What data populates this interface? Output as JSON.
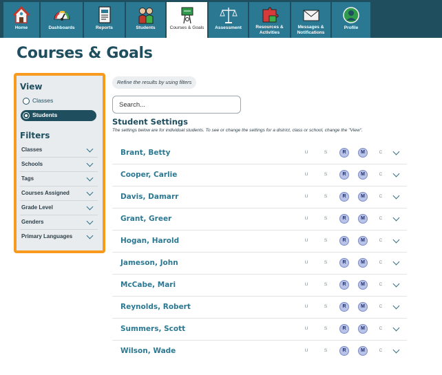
{
  "nav": {
    "items": [
      {
        "label": "Home",
        "icon": "home-icon"
      },
      {
        "label": "Dashboards",
        "icon": "dashboard-gauge-icon"
      },
      {
        "label": "Reports",
        "icon": "report-document-icon"
      },
      {
        "label": "Students",
        "icon": "students-icon"
      },
      {
        "label": "Courses & Goals",
        "icon": "courses-goals-icon",
        "active": true
      },
      {
        "label": "Assessment",
        "icon": "scale-icon"
      },
      {
        "label": "Resources & Activities",
        "line1": "Resources &",
        "line2": "Activities",
        "icon": "puzzle-icon"
      },
      {
        "label": "Messages & Notifications",
        "line1": "Messages &",
        "line2": "Notifications",
        "icon": "envelope-icon"
      },
      {
        "label": "Profile",
        "icon": "profile-avatar-icon"
      }
    ]
  },
  "page": {
    "title": "Courses & Goals"
  },
  "sidebar": {
    "view_heading": "View",
    "view_options": [
      {
        "label": "Classes",
        "selected": false
      },
      {
        "label": "Students",
        "selected": true
      }
    ],
    "filters_heading": "Filters",
    "filters": [
      {
        "label": "Classes"
      },
      {
        "label": "Schools"
      },
      {
        "label": "Tags"
      },
      {
        "label": "Courses Assigned"
      },
      {
        "label": "Grade Level"
      },
      {
        "label": "Genders"
      },
      {
        "label": "Primary Languages"
      }
    ]
  },
  "main": {
    "hint": "Refine the results by using filters",
    "search_placeholder": "Search...",
    "section_title": "Student Settings",
    "section_desc": "The settings below are for individual students. To see or change the settings for a district, class or school, change the \"View\".",
    "level_labels": {
      "u": "U",
      "s": "S",
      "r": "R",
      "m": "M",
      "c": "C"
    },
    "students": [
      {
        "name": "Brant, Betty"
      },
      {
        "name": "Cooper, Carlie"
      },
      {
        "name": "Davis, Damarr"
      },
      {
        "name": "Grant, Greer"
      },
      {
        "name": "Hogan, Harold"
      },
      {
        "name": "Jameson, John"
      },
      {
        "name": "McCabe, Mari"
      },
      {
        "name": "Reynolds, Robert"
      },
      {
        "name": "Summers, Scott"
      },
      {
        "name": "Wilson, Wade"
      }
    ]
  },
  "colors": {
    "nav_bg": "#1f4e5f",
    "nav_tile": "#2b7893",
    "highlight": "#f79a1e",
    "badge": "#b9c3e8",
    "name_link": "#2b7893"
  }
}
